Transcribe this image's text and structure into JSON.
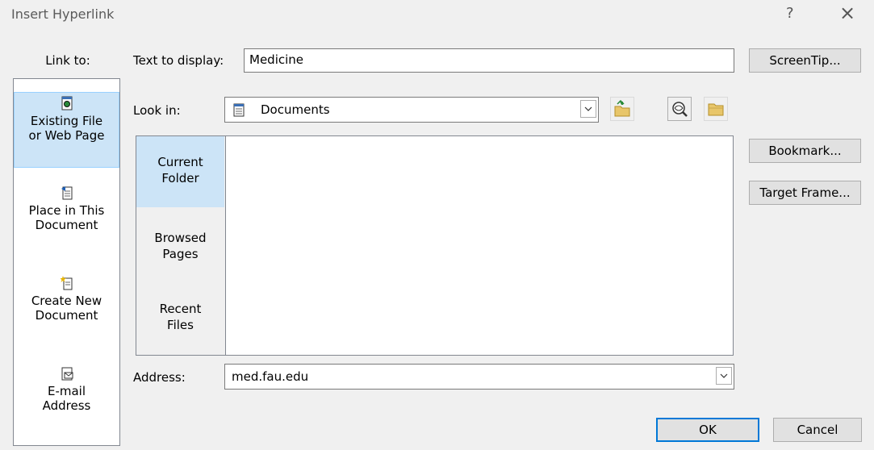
{
  "window": {
    "title": "Insert Hyperlink",
    "help_glyph": "?",
    "close_glyph": "×"
  },
  "link_to": {
    "label": "Link to:",
    "items": [
      {
        "line1": "Existing File",
        "line2": "or Web Page",
        "icon": "web-page-icon",
        "selected": true
      },
      {
        "line1": "Place in This",
        "line2": "Document",
        "icon": "place-in-document-icon",
        "selected": false
      },
      {
        "line1": "Create New",
        "line2": "Document",
        "icon": "new-document-icon",
        "selected": false
      },
      {
        "line1": "E-mail",
        "line2": "Address",
        "icon": "email-icon",
        "selected": false
      }
    ]
  },
  "text_to_display": {
    "label": "Text to display:",
    "value": "Medicine"
  },
  "look_in": {
    "label": "Look in:",
    "value": "Documents"
  },
  "browse_tabs": [
    {
      "line1": "Current",
      "line2": "Folder",
      "selected": true
    },
    {
      "line1": "Browsed",
      "line2": "Pages",
      "selected": false
    },
    {
      "line1": "Recent",
      "line2": "Files",
      "selected": false
    }
  ],
  "address": {
    "label": "Address:",
    "value": "med.fau.edu"
  },
  "buttons": {
    "screentip": "ScreenTip...",
    "bookmark": "Bookmark...",
    "target_frame": "Target Frame...",
    "ok": "OK",
    "cancel": "Cancel"
  },
  "colors": {
    "selection": "#cce4f7",
    "default_button_border": "#0078d7",
    "dialog_bg": "#f0f0f0"
  }
}
